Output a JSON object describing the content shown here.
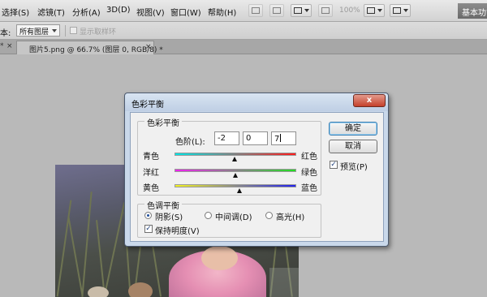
{
  "menubar": {
    "items": [
      "选择(S)",
      "滤镜(T)",
      "分析(A)",
      "3D(D)",
      "视图(V)",
      "窗口(W)",
      "帮助(H)"
    ],
    "zoom": "100%",
    "workspace": "基本功能"
  },
  "options": {
    "sample_label": "本:",
    "sample_value": "所有图层",
    "ring_label": "显示取样环"
  },
  "tabs": {
    "prev_marker": "*",
    "prev_close": "×",
    "doc_title": "图片5.png @ 66.7% (图层 0, RGB/8) *",
    "doc_close": "×"
  },
  "dialog": {
    "title": "色彩平衡",
    "close": "x",
    "balance_group": "色彩平衡",
    "level_label": "色阶(L):",
    "levels": [
      "-2",
      "0",
      "7"
    ],
    "sliders": [
      {
        "left": "青色",
        "right": "红色",
        "value": -2
      },
      {
        "left": "洋红",
        "right": "绿色",
        "value": 0
      },
      {
        "left": "黄色",
        "right": "蓝色",
        "value": 7
      }
    ],
    "slider_range": [
      -100,
      100
    ],
    "tone_group": "色调平衡",
    "tone_options": [
      "阴影(S)",
      "中间调(D)",
      "高光(H)"
    ],
    "tone_selected": 0,
    "preserve_luminosity": "保持明度(V)",
    "preserve_checked": true,
    "ok": "确定",
    "cancel": "取消",
    "preview": "预览(P)",
    "preview_checked": true,
    "check_mark": "✓"
  },
  "colors": {
    "dialog_frame": "#c9d8ea",
    "close_button": "#c4402b",
    "canvas_bg": "#b9b9b9"
  }
}
